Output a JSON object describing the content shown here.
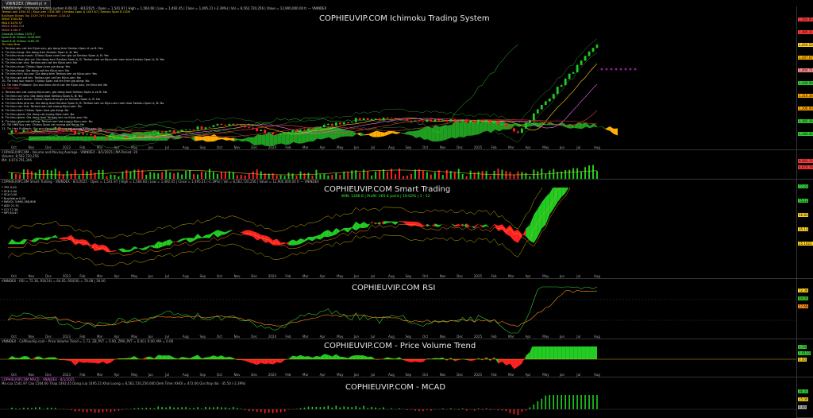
{
  "tab": {
    "label": "VNINDEX (Weekly) ×"
  },
  "panes": {
    "ichimoku": {
      "header": "VNINDEX(W) - Ichimoku trading system 6.06.02 - 8/1/2025 - Open = 1,541.97 | High = 1,564.60 | Low = 1,492.45 | Close = 1,495.21 (-2.39%) | Vol = 8,562,720,256 | Value = 12,900,000.00 tr — VNINDEX",
      "watermark": "COPHIEUVIP.COM Ichimoku Trading System",
      "indicators": [
        {
          "text": "Tenkan-sen 1454.52 | Kijun-sen 1316.365 | Senkou Span A 1447.67 | Senkou Span B 1206",
          "color": "#ffd21f"
        },
        {
          "text": "Bollinger Bands Top 1529.749 | Bottom 1144.42",
          "color": "#ff9a2f"
        },
        {
          "text": "SMA5 1504.62",
          "color": "#ffd21f"
        },
        {
          "text": "MA10 1470.57",
          "color": "#ffd21f"
        },
        {
          "text": "MA20 1404.714",
          "color": "#ff8c8c"
        },
        {
          "text": "MA50 1330.5",
          "color": "#ff8c8c"
        },
        {
          "text": "Close-At Chikou 1075.7",
          "color": "#7dff7d"
        },
        {
          "text": "Span B At Chikou 1249.805",
          "color": "#7dff7d"
        },
        {
          "text": "Span B At Chikou 1165.35",
          "color": "#7dff7d"
        }
      ],
      "buy_heading": "Tin hieu Mua",
      "buy_signals": [
        "1. Tenkan-sen cat len Kijun-sen, gia dong tren Senkou Span A va B: Yes",
        "2. Tin hieu tang: Gia dong tren Senkou Span A, B: Yes",
        "3. Tin hieu mua manh: Chikou Span nam tren gia va Senkou Span A, B: Yes",
        "4. Tin hieu Mua pha vo: Gia dong tren Senkou Span A, B. Tenkan-sen va Kijun-sen nam tren Senkou Span A, B: Yes",
        "5. Tin hieu can chu: Tenkan-sen cat len Kijun-sen: No",
        "6. Tin hieu mua: Chikou Span tren gia dong: Yes",
        "7. Tin hieu tang: Gia dong cat len Kijun-sen: No",
        "8. Tin hieu tich luy pro: Gia dong tren Tenkan-sen va Kijun-sen: Yes",
        "9. Tin hieu gia cat len: Tenkan-sen cat len Kijun-sen: No",
        "10. Tin hieu suc manh: Chikou Span cat len tren gia dong: No",
        "11. Tin hieu Pullback: Gia sau dieu chinh cat len Kijun-sen, tin hieu tot: No"
      ],
      "sell_heading": "Tin hieu Ban",
      "sell_signals": [
        "1. Tenkan-sen cat xuong Kijun-sen, gia dong duoi Senkou Span A va B: No",
        "2. Tin hieu suy yeu: Gia dong duoi Senkou Span A, B: No",
        "3. Tin hieu ban manh: Chikou Span duoi gia va Senkou Span A, B: No",
        "4. Tin hieu Ban pha vo: Gia dong duoi Senkou Span A, B. Tenkan-sen va Kijun-sen nam duoi Senkou Span A, B: No",
        "5. Tin hieu can chu: Tenkan-sen cat xuong Kijun-sen: No",
        "6. Tin hieu ban: Chikou Span duoi gia dong: No",
        "7. Tin hieu giam: Gia dong cat xuong Kijun-sen: No",
        "8. Tin hieu giam: Gia dong duoi Tenkan-sen va Kijun-sen: No",
        "9. Tin hieu giam cat xuong: Tenkan-sen cat xuong Kijun-sen: No",
        "10. Tin hieu suy yeu: Chikou Span cat xuong gia dong: No",
        "11. Tin hieu Pullback: Gia sau dieu chinh tang cat xuong Kijun-sen: No"
      ],
      "price_labels": [
        {
          "text": "1,564.60",
          "color": "#ff4040"
        },
        {
          "text": "1,495.21",
          "color": "#ff3b3b"
        },
        {
          "text": "1,454.52",
          "color": "#ffd21f"
        },
        {
          "text": "1,447.67",
          "color": "#ffb000"
        },
        {
          "text": "1,404.71",
          "color": "#ff8c8c"
        },
        {
          "text": "1,330.50",
          "color": "#33cc33"
        },
        {
          "text": "1,316.36",
          "color": "#ffa500"
        },
        {
          "text": "1,206.00",
          "color": "#ffa500"
        },
        {
          "text": "1,165.35",
          "color": "#33cc33"
        },
        {
          "text": "1,144.42",
          "color": "#33cc33"
        }
      ]
    },
    "volume": {
      "header": "COPHIEUVIP.COM - Volume and Moving Average - VNINDEX - 8/1/2025 | MA Period: 20",
      "line2": "Volume: 8,562,720,256",
      "line3": "MA: 4,674,791,306",
      "labels": [
        {
          "text": "8,562.72M",
          "color": "#ff3b3b"
        },
        {
          "text": "4,674.79M",
          "color": "#ff3b3b"
        }
      ]
    },
    "smart": {
      "header": "COPHIEUVIP.COM Smart Trading - VNINDEX - 8/1/2025 - Open = 1,541.97 | High = 1,564.60 | Low = 1,492.45 | Close = 1,495.21 (-2.39%) | Vol = 8,562,720,256 | Value = 12,900,000.00 tr — VNINDEX",
      "watermark": "COPHIEUVIP.COM Smart Trading",
      "stat": "WIN: 1266.6 | Profit: 265.4 point | 19.02% | 1 - 12",
      "panel": [
        "* TPS 0.00",
        "* SCK 0.00",
        "* SCA 0.00",
        "* Buy/Value 0.00",
        "* MAVOL 3,660,188,606",
        "* ADX 21.51",
        "* CCI 72.36",
        "* MFI 64.47"
      ],
      "labels": [
        {
          "text": "77.23",
          "color": "#33cc33"
        },
        {
          "text": "75.12",
          "color": "#33cc33"
        },
        {
          "text": "56.83",
          "color": "#ffd21f"
        },
        {
          "text": "35.13",
          "color": "#ffd21f"
        },
        {
          "text": "25.1022",
          "color": "#ffd21f"
        }
      ]
    },
    "rsi": {
      "header": "VNINDEX - RSI = 72.36, RSI(14) = 64.05, RSI(50) = 70.08 | 30.00",
      "watermark": "COPHIEUVIP.COM RSI",
      "labels": [
        {
          "text": "72.36",
          "color": "#ffd21f"
        },
        {
          "text": "64.05",
          "color": "#33cc33"
        },
        {
          "text": "57.66",
          "color": "#ff8c1a"
        }
      ]
    },
    "pvt": {
      "header": "VNINDEX - CoPhieuVip.com - Price Volume Trend = 1.73, ZB_PVT = 0.00, ZMA_PVT = 0.00 | 0.00, MA = 0.00",
      "watermark": "COPHIEUVIP.COM - Price Volume Trend",
      "labels": [
        {
          "text": "1.73",
          "color": "#33cc33"
        },
        {
          "text": "1.0122",
          "color": "#33cc33"
        },
        {
          "text": "0.00",
          "color": "#ffd21f"
        }
      ]
    },
    "macd": {
      "header": "COPHIEUVIP.COM MACD - VNINDEX - 8/1/2025",
      "line2": "Mo cua 1541.97   Cao 1564.60   Thap 1492.45   Dong cua 1495.21   Khoi Luong = 8,562,720,256.000   Dem Time: KHOI = 472.00   Gia thay doi: -35.50 (-2.39%)",
      "watermark": "COPHIEUVIP.COM - MCAD",
      "labels": [
        {
          "text": "36.31",
          "color": "#33cc33"
        },
        {
          "text": "25.00",
          "color": "#ffd21f"
        },
        {
          "text": "0.00",
          "color": "#aaa"
        }
      ]
    }
  },
  "x_axis": [
    "Oct",
    "Nov",
    "Dec",
    "2023",
    "Feb",
    "Mar",
    "Apr",
    "May",
    "Jun",
    "Jul",
    "Aug",
    "Sep",
    "Oct",
    "Nov",
    "Dec",
    "2024",
    "Feb",
    "Mar",
    "Apr",
    "May",
    "Jun",
    "Jul",
    "Aug",
    "Sep",
    "Oct",
    "Nov",
    "Dec",
    "2025",
    "Feb",
    "Mar",
    "Apr",
    "May",
    "Jun",
    "Jul",
    "Aug"
  ],
  "colors": {
    "bull": "#22cc22",
    "bear": "#ff2222",
    "cloud_up": "#1f9e1f",
    "cloud_down": "#ffb000",
    "bg": "#000000"
  }
}
